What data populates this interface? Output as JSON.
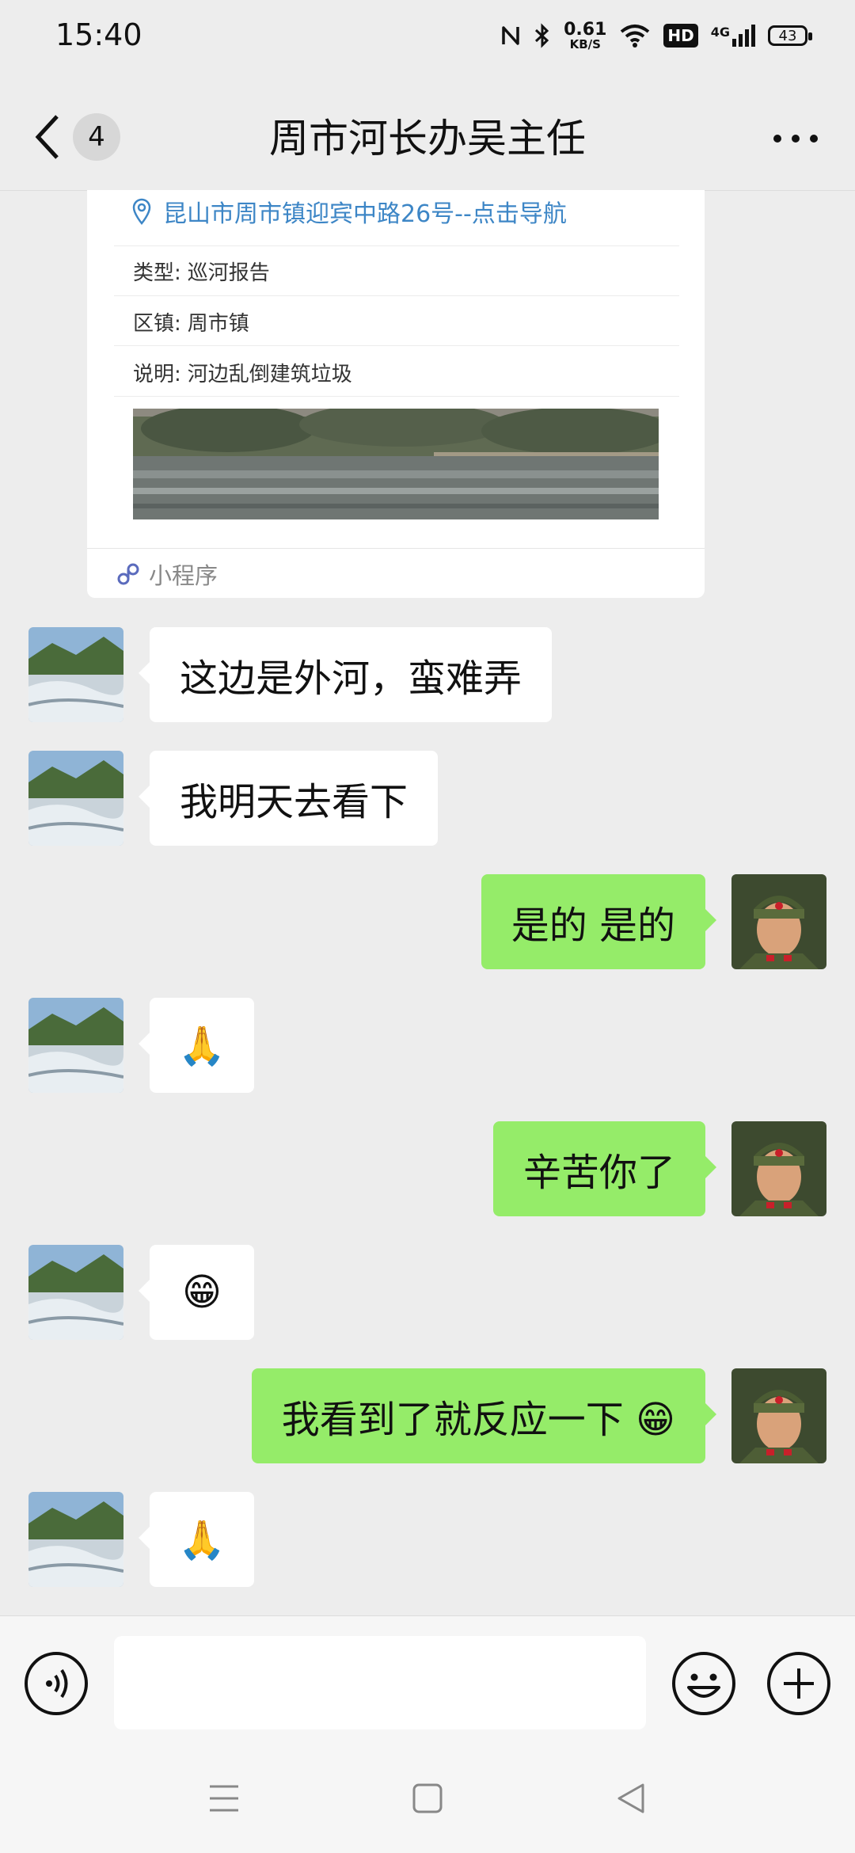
{
  "status": {
    "time": "15:40",
    "net_speed": "0.61",
    "net_unit": "KB/S",
    "hd": "HD",
    "signal": "4G",
    "battery": "43"
  },
  "header": {
    "unread_count": "4",
    "title": "周市河长办吴主任"
  },
  "card": {
    "location": "昆山市周市镇迎宾中路26号--点击导航",
    "rows": [
      {
        "label": "类型:",
        "value": "巡河报告"
      },
      {
        "label": "区镇:",
        "value": "周市镇"
      },
      {
        "label": "说明:",
        "value": "河边乱倒建筑垃圾"
      }
    ],
    "source": "小程序"
  },
  "messages": [
    {
      "side": "in",
      "text": "这边是外河，蛮难弄"
    },
    {
      "side": "in",
      "text": "我明天去看下"
    },
    {
      "side": "out",
      "text": "是的 是的"
    },
    {
      "side": "in",
      "text": "🙏"
    },
    {
      "side": "out",
      "text": "辛苦你了"
    },
    {
      "side": "in",
      "text": "😁"
    },
    {
      "side": "out",
      "text": "我看到了就反应一下 😁"
    },
    {
      "side": "in",
      "text": "🙏"
    }
  ],
  "input": {
    "value": ""
  },
  "colors": {
    "outgoing_bubble": "#95ec69",
    "incoming_bubble": "#ffffff",
    "background": "#ededed",
    "link": "#3d86c6"
  },
  "icons": {
    "back": "chevron-left-icon",
    "more": "ellipsis-icon",
    "location": "location-pin-icon",
    "miniprogram": "miniprogram-link-icon",
    "voice": "voice-icon",
    "emoji": "smiley-icon",
    "plus": "plus-icon"
  }
}
